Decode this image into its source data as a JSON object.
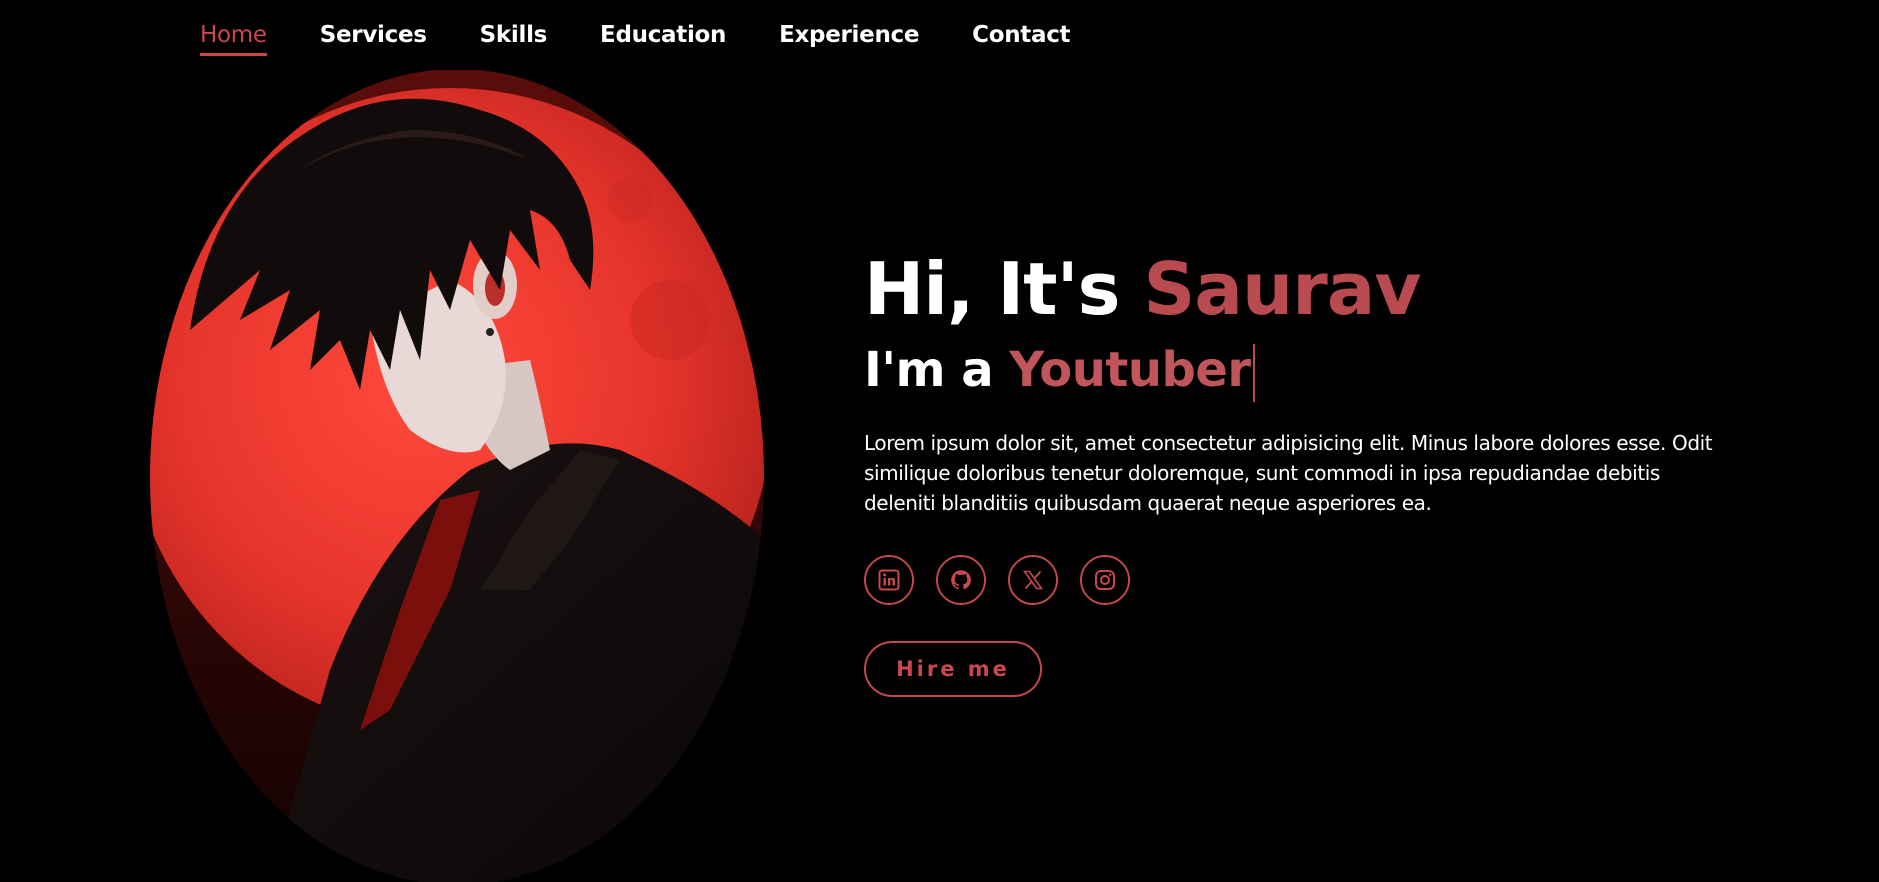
{
  "nav": {
    "items": [
      {
        "label": "Home",
        "active": true
      },
      {
        "label": "Services"
      },
      {
        "label": "Skills"
      },
      {
        "label": "Education"
      },
      {
        "label": "Experience"
      },
      {
        "label": "Contact"
      }
    ]
  },
  "hero": {
    "greeting": "Hi, It's ",
    "name": "Saurav",
    "role_prefix": "I'm a ",
    "role_word": "Youtuber",
    "description": "Lorem ipsum dolor sit, amet consectetur adipisicing elit. Minus labore dolores esse. Odit similique doloribus tenetur doloremque, sunt commodi in ipsa repudiandae debitis deleniti blanditiis quibusdam quaerat neque asperiores ea.",
    "hire_label": "Hire me"
  },
  "socials": [
    {
      "icon": "linkedin-icon"
    },
    {
      "icon": "github-icon"
    },
    {
      "icon": "x-icon"
    },
    {
      "icon": "instagram-icon"
    }
  ],
  "colors": {
    "background": "#000000",
    "accent": "#c9474e",
    "name": "#b94a50",
    "moon": "#e83a32"
  }
}
